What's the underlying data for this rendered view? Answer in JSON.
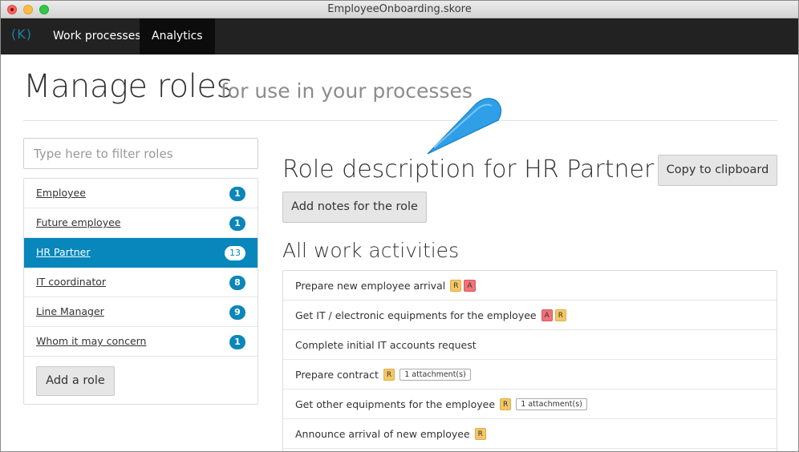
{
  "window": {
    "title": "EmployeeOnboarding.skore"
  },
  "navbar": {
    "logo": "(K)",
    "items": [
      {
        "label": "Work processes",
        "active": false
      },
      {
        "label": "Analytics",
        "active": true
      }
    ]
  },
  "header": {
    "title": "Manage roles",
    "subtitle": "for use in your processes"
  },
  "filter": {
    "placeholder": "Type here to filter roles",
    "value": ""
  },
  "roles": {
    "items": [
      {
        "name": "Employee",
        "count": "1",
        "active": false
      },
      {
        "name": "Future employee",
        "count": "1",
        "active": false
      },
      {
        "name": "HR Partner",
        "count": "13",
        "active": true
      },
      {
        "name": "IT coordinator",
        "count": "8",
        "active": false
      },
      {
        "name": "Line Manager",
        "count": "9",
        "active": false
      },
      {
        "name": "Whom it may concern",
        "count": "1",
        "active": false
      }
    ],
    "add_label": "Add a role"
  },
  "detail": {
    "heading": "Role description for HR Partner",
    "copy_label": "Copy to clipboard",
    "notes_label": "Add notes for the role",
    "activities_heading": "All work activities",
    "activities": [
      {
        "label": "Prepare new employee arrival",
        "tags": [
          "R",
          "A"
        ],
        "attachment": ""
      },
      {
        "label": "Get IT / electronic equipments for the employee",
        "tags": [
          "A",
          "R"
        ],
        "attachment": ""
      },
      {
        "label": "Complete initial IT accounts request",
        "tags": [],
        "attachment": ""
      },
      {
        "label": "Prepare contract",
        "tags": [
          "R"
        ],
        "attachment": "1 attachment(s)"
      },
      {
        "label": "Get other equipments for the employee",
        "tags": [
          "R"
        ],
        "attachment": "1 attachment(s)"
      },
      {
        "label": "Announce arrival of new employee",
        "tags": [
          "R"
        ],
        "attachment": ""
      }
    ]
  },
  "colors": {
    "accent": "#0787bb",
    "navbar": "#222222",
    "tag_r": "#f4c766",
    "tag_a": "#f0727a",
    "callout": "#2f9fe8"
  }
}
